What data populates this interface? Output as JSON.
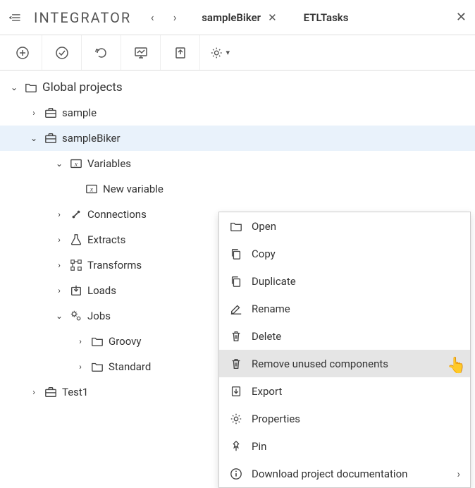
{
  "header": {
    "app_title": "INTEGRATOR",
    "tabs": [
      {
        "label": "sampleBiker",
        "closable": true
      },
      {
        "label": "ETLTasks",
        "closable": false
      }
    ]
  },
  "tree": {
    "root": "Global projects",
    "items": [
      {
        "label": "sample",
        "type": "briefcase",
        "expanded": false
      },
      {
        "label": "sampleBiker",
        "type": "briefcase",
        "expanded": true,
        "selected": true,
        "children": [
          {
            "label": "Variables",
            "type": "variable",
            "expanded": true,
            "children": [
              {
                "label": "New variable",
                "type": "variable"
              }
            ]
          },
          {
            "label": "Connections",
            "type": "connection",
            "expanded": false
          },
          {
            "label": "Extracts",
            "type": "extract",
            "expanded": false
          },
          {
            "label": "Transforms",
            "type": "transform",
            "expanded": false
          },
          {
            "label": "Loads",
            "type": "load",
            "expanded": false
          },
          {
            "label": "Jobs",
            "type": "job",
            "expanded": true,
            "children": [
              {
                "label": "Groovy",
                "type": "folder",
                "expanded": false
              },
              {
                "label": "Standard",
                "type": "folder",
                "expanded": false
              }
            ]
          }
        ]
      },
      {
        "label": "Test1",
        "type": "briefcase",
        "expanded": false
      }
    ]
  },
  "context_menu": {
    "items": [
      {
        "label": "Open",
        "icon": "folder"
      },
      {
        "label": "Copy",
        "icon": "copy"
      },
      {
        "label": "Duplicate",
        "icon": "duplicate"
      },
      {
        "label": "Rename",
        "icon": "rename"
      },
      {
        "label": "Delete",
        "icon": "trash"
      },
      {
        "label": "Remove unused components",
        "icon": "trash",
        "highlighted": true
      },
      {
        "label": "Export",
        "icon": "export"
      },
      {
        "label": "Properties",
        "icon": "gear"
      },
      {
        "label": "Pin",
        "icon": "pin"
      },
      {
        "label": "Download project documentation",
        "icon": "info",
        "has_submenu": true
      }
    ]
  }
}
